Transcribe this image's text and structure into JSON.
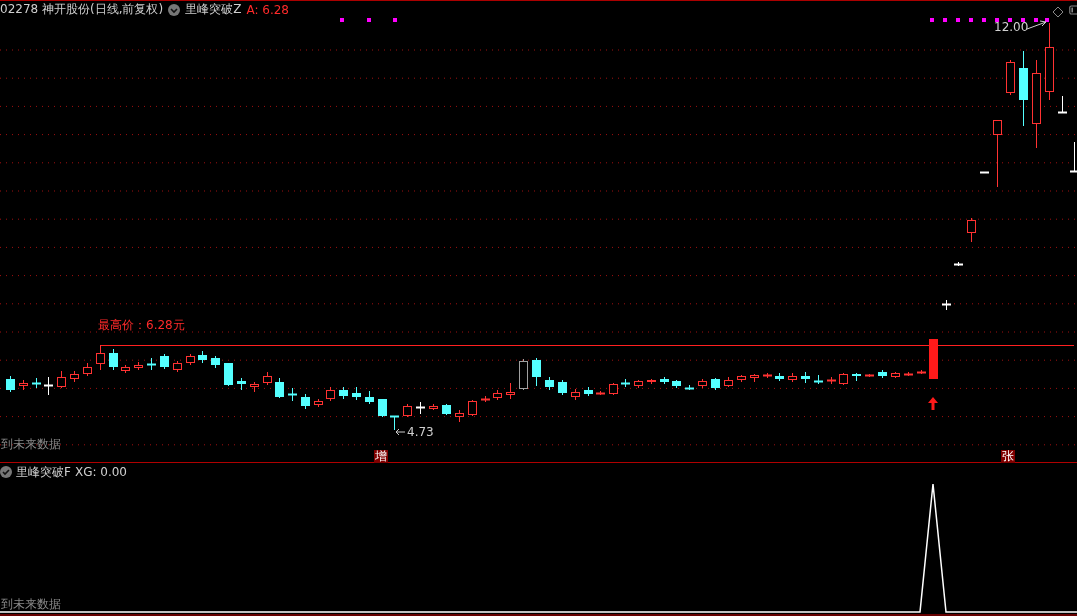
{
  "main_panel": {
    "security": "02278 神开股份(日线,前复权)",
    "indicator": "里峰突破Z",
    "indicator_value": "A: 6.28",
    "high_label": "最高价：6.28元",
    "low_label": "4.73",
    "peak_label": "12.00",
    "markers": [
      {
        "text": "增"
      },
      {
        "text": "张"
      }
    ],
    "footnote": "到未来数据"
  },
  "sub_panel": {
    "indicator": "里峰突破F",
    "indicator_value": "XG: 0.00",
    "footnote": "到未来数据"
  }
}
